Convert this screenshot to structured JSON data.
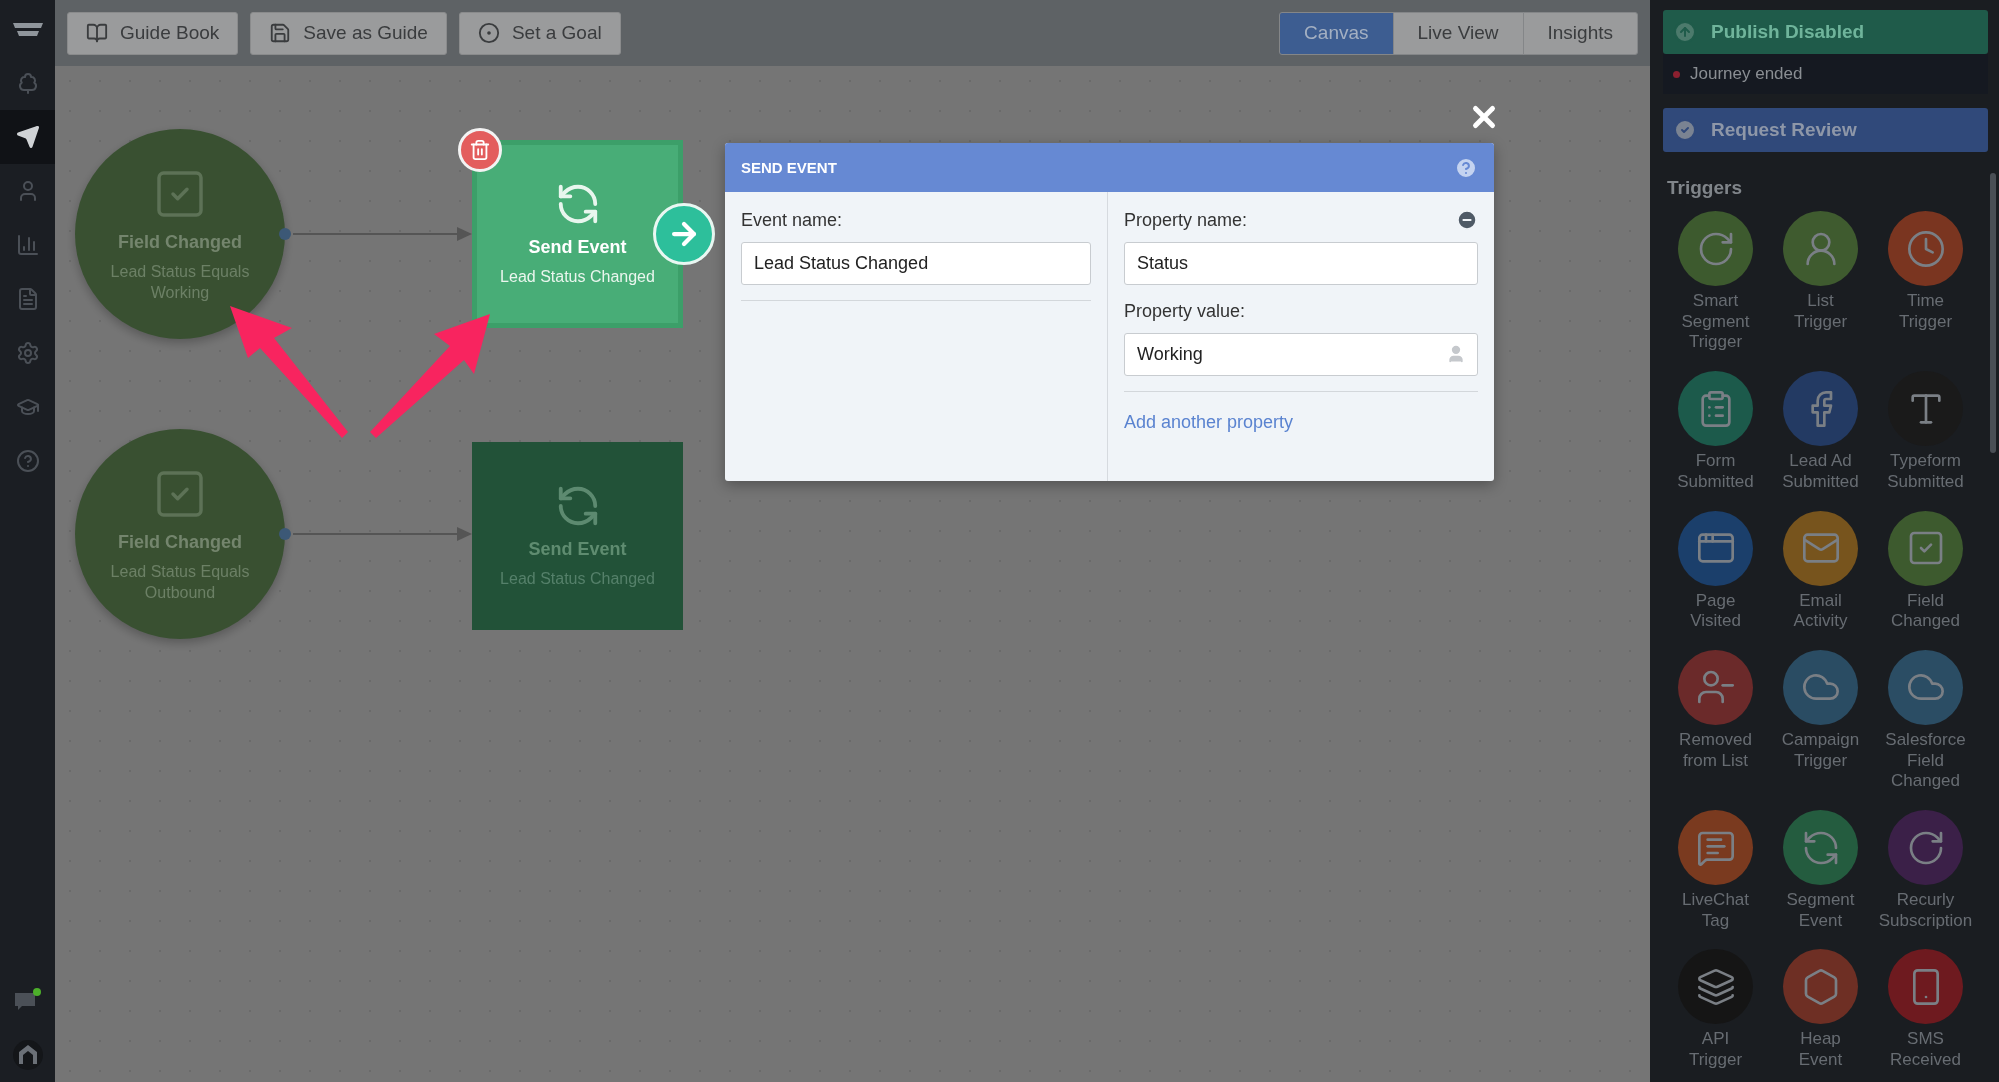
{
  "nav_items": [
    {
      "selected": false
    },
    {
      "selected": true
    },
    {
      "selected": false
    },
    {
      "selected": false
    },
    {
      "selected": false
    },
    {
      "selected": false
    },
    {
      "selected": false
    },
    {
      "selected": false
    }
  ],
  "toolbar": {
    "buttons": [
      "Guide Book",
      "Save as Guide",
      "Set a Goal"
    ],
    "tabs": [
      {
        "label": "Canvas",
        "selected": true
      },
      {
        "label": "Live View",
        "selected": false
      },
      {
        "label": "Insights",
        "selected": false
      }
    ]
  },
  "canvas": {
    "nodes": [
      {
        "kind": "trigger",
        "title": "Field Changed",
        "subtitle": "Lead Status Equals Working",
        "selected": false
      },
      {
        "kind": "action",
        "title": "Send Event",
        "subtitle": "Lead Status Changed",
        "selected": true
      },
      {
        "kind": "trigger",
        "title": "Field Changed",
        "subtitle": "Lead Status Equals Outbound",
        "selected": false
      },
      {
        "kind": "action",
        "title": "Send Event",
        "subtitle": "Lead Status Changed",
        "selected": false
      }
    ]
  },
  "dialog": {
    "title": "SEND EVENT",
    "event_name_label": "Event name:",
    "event_name": "Lead Status Changed",
    "property_name_label": "Property name:",
    "property_name": "Status",
    "property_value_label": "Property value:",
    "property_value": "Working",
    "add_link": "Add another property"
  },
  "sidebar": {
    "publish": "Publish Disabled",
    "status": "Journey ended",
    "review": "Request Review",
    "section": "Triggers",
    "triggers": [
      {
        "label": "Smart\nSegment\nTrigger",
        "color": "#3d5a2e"
      },
      {
        "label": "List\nTrigger",
        "color": "#3f5b2f"
      },
      {
        "label": "Time\nTrigger",
        "color": "#7a3520"
      },
      {
        "label": "Form\nSubmitted",
        "color": "#1c5a4b"
      },
      {
        "label": "Lead Ad\nSubmitted",
        "color": "#233a63"
      },
      {
        "label": "Typeform\nSubmitted",
        "color": "#1a1a1a"
      },
      {
        "label": "Page\nVisited",
        "color": "#1b3f6b"
      },
      {
        "label": "Email\nActivity",
        "color": "#77541d"
      },
      {
        "label": "Field\nChanged",
        "color": "#3d5a2e"
      },
      {
        "label": "Removed\nfrom List",
        "color": "#6b2a2a"
      },
      {
        "label": "Campaign\nTrigger",
        "color": "#2a4c63"
      },
      {
        "label": "Salesforce\nField\nChanged",
        "color": "#2b4d64"
      },
      {
        "label": "LiveChat\nTag",
        "color": "#7a3a1f"
      },
      {
        "label": "Segment\nEvent",
        "color": "#245c3f"
      },
      {
        "label": "Recurly\nSubscription",
        "color": "#3b2048"
      },
      {
        "label": "API\nTrigger",
        "color": "#151515"
      },
      {
        "label": "Heap\nEvent",
        "color": "#6e2f24"
      },
      {
        "label": "SMS\nReceived",
        "color": "#6e1a1f"
      }
    ]
  }
}
